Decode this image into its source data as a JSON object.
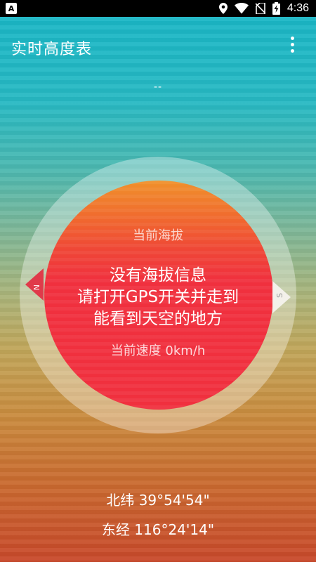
{
  "status_bar": {
    "app_icon": "A",
    "time": "4:36",
    "icons": [
      "location-icon",
      "wifi-icon",
      "no-sim-icon",
      "battery-charging-icon"
    ]
  },
  "app_bar": {
    "title": "实时高度表",
    "menu_icon": "overflow-menu-icon"
  },
  "top_value": "--",
  "dial": {
    "altitude_label": "当前海拔",
    "message_line1": "没有海拔信息",
    "message_line2": "请打开GPS开关并走到",
    "message_line3": "能看到天空的地方",
    "speed_text": "当前速度 0km/h",
    "north_marker": "N",
    "south_marker": "S",
    "disc_color": "#f0303e"
  },
  "coordinates": {
    "latitude": "北纬 39°54'54\"",
    "longitude": "东经 116°24'14\""
  }
}
